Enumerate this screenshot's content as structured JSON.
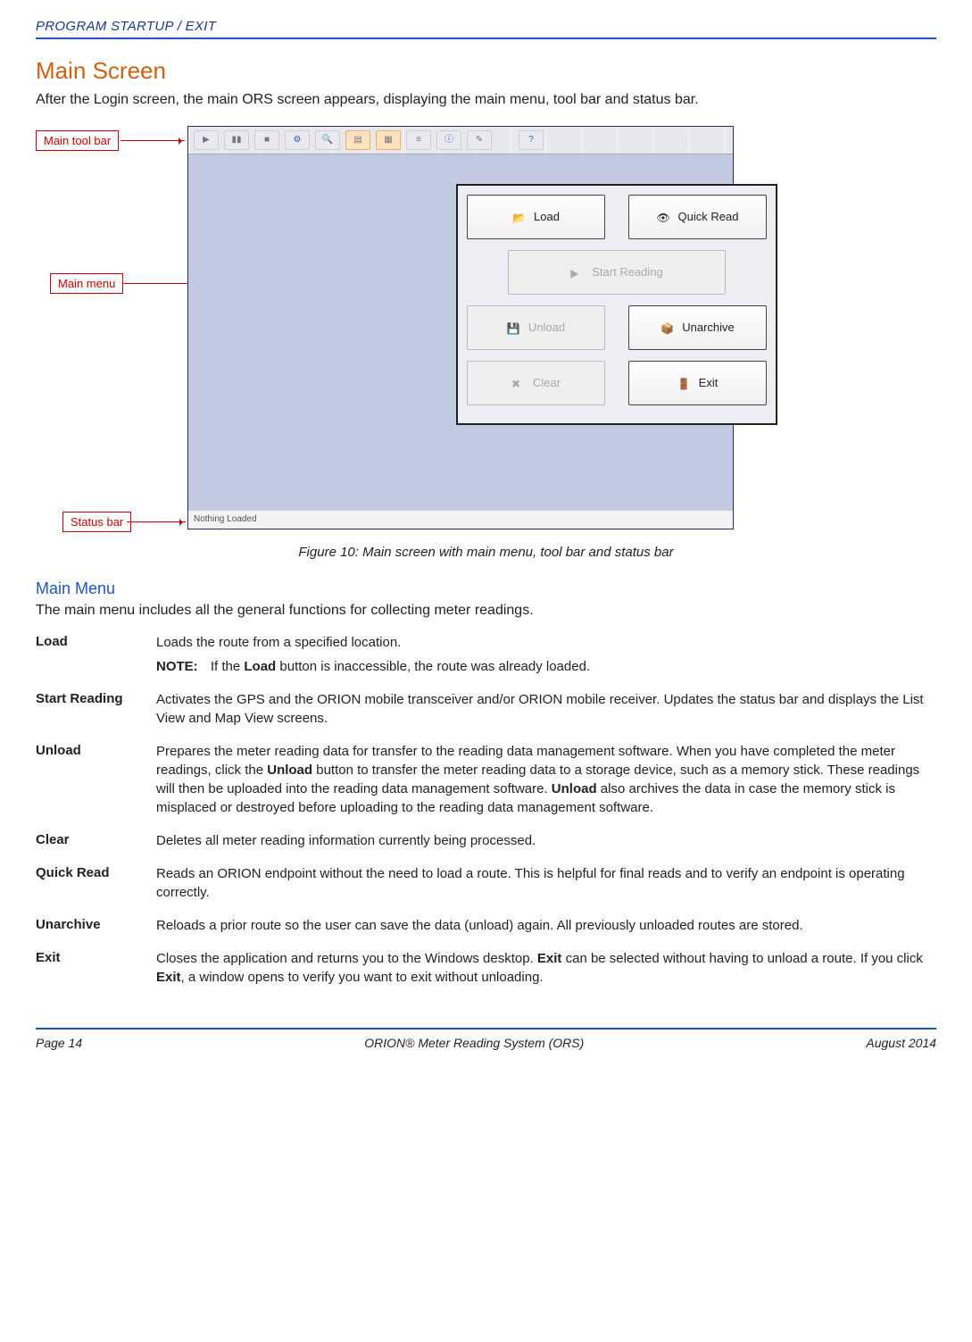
{
  "header": {
    "section": "PROGRAM STARTUP / EXIT"
  },
  "main": {
    "title": "Main Screen",
    "intro": "After the Login screen, the main ORS screen appears, displaying the main menu, tool bar and status bar."
  },
  "callouts": {
    "toolbar": "Main tool bar",
    "menu": "Main menu",
    "status": "Status bar"
  },
  "screenshot": {
    "buttons": {
      "load": "Load",
      "quickread": "Quick Read",
      "start": "Start Reading",
      "unload": "Unload",
      "unarchive": "Unarchive",
      "clear": "Clear",
      "exit": "Exit"
    },
    "status_text": "Nothing Loaded"
  },
  "figure_caption": "Figure 10:  Main screen with main menu, tool bar and status bar",
  "subhead": "Main Menu",
  "subintro": "The main menu includes all the general functions for collecting meter readings.",
  "defs": {
    "load": {
      "term": "Load",
      "desc": "Loads the route from a specified location.",
      "note_label": "NOTE:",
      "note_pre": "If the ",
      "note_bold": "Load",
      "note_post": " button is inaccessible, the route was already loaded."
    },
    "start": {
      "term": "Start Reading",
      "desc": "Activates the GPS and the ORION mobile transceiver and/or ORION mobile receiver. Updates the status bar and displays the List View and Map View screens."
    },
    "unload": {
      "term": "Unload",
      "d1": "Prepares the meter reading data for transfer to the reading data management software. When you have completed the meter readings, click the ",
      "b1": "Unload",
      "d2": " button to transfer the meter reading data to a storage device, such as a memory stick. These readings will then be uploaded into the reading data management software. ",
      "b2": "Unload",
      "d3": " also archives the data in case the memory stick is misplaced or destroyed before uploading to the reading data management software."
    },
    "clear": {
      "term": "Clear",
      "desc": "Deletes all meter reading information currently being processed."
    },
    "quickread": {
      "term": "Quick Read",
      "desc": "Reads an ORION endpoint without the need to load a route. This is helpful for final reads and to verify an endpoint is operating correctly."
    },
    "unarchive": {
      "term": "Unarchive",
      "desc": "Reloads a prior route so the user can save the data (unload) again. All previously unloaded routes are stored."
    },
    "exit": {
      "term": "Exit",
      "d1": "Closes the application and returns you to the Windows desktop. ",
      "b1": "Exit",
      "d2": " can be selected without having to unload a route. If you click ",
      "b2": "Exit",
      "d3": ", a window opens to verify you want to exit without unloading."
    }
  },
  "footer": {
    "page": "Page 14",
    "title": "ORION® Meter Reading System (ORS)",
    "date": "August  2014"
  }
}
